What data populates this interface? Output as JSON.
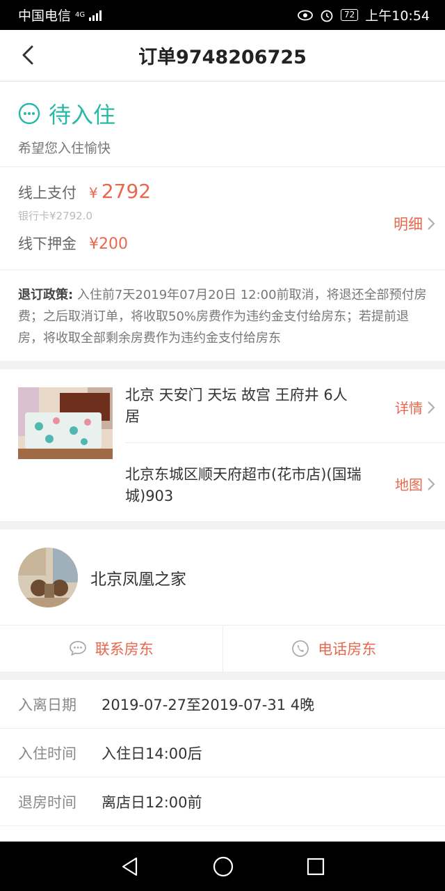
{
  "status_bar": {
    "carrier": "中国电信",
    "network": "4G",
    "battery": "72",
    "time": "上午10:54"
  },
  "nav": {
    "title": "订单9748206725"
  },
  "status": {
    "title": "待入住",
    "subtitle": "希望您入住愉快"
  },
  "payment": {
    "online_label": "线上支付",
    "currency": "¥",
    "online_amount": "2792",
    "online_method": "银行卡¥2792.0",
    "deposit_label": "线下押金",
    "deposit_amount": "¥200",
    "detail_label": "明细"
  },
  "policy": {
    "label": "退订政策:",
    "text": " 入住前7天2019年07月20日 12:00前取消，将退还全部预付房费；之后取消订单，将收取50%房费作为违约金支付给房东；若提前退房，将收取全部剩余房费作为违约金支付给房东"
  },
  "house": {
    "title": "北京 天安门 天坛 故宫 王府井 6人居",
    "detail_label": "详情",
    "address": "北京东城区顺天府超市(花市店)(国瑞城)903",
    "map_label": "地图"
  },
  "host": {
    "name": "北京凤凰之家",
    "contact_label": "联系房东",
    "call_label": "电话房东"
  },
  "info": [
    {
      "label": "入离日期",
      "value": "2019-07-27至2019-07-31  4晚"
    },
    {
      "label": "入住时间",
      "value": "入住日14:00后"
    },
    {
      "label": "退房时间",
      "value": "离店日12:00前"
    }
  ],
  "colors": {
    "accent_teal": "#27b8a8",
    "accent_red": "#e8674d"
  }
}
